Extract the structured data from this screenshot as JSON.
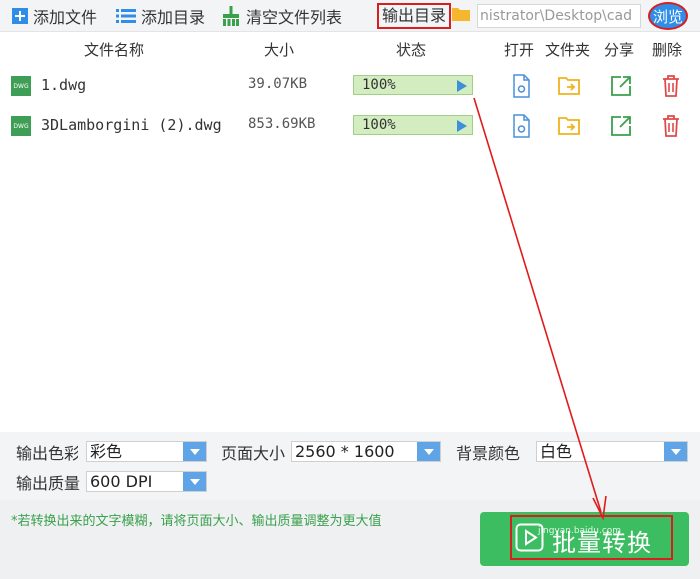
{
  "toolbar": {
    "add_file": "添加文件",
    "add_dir": "添加目录",
    "clear_list": "清空文件列表",
    "output_dir_label": "输出目录",
    "output_path": "nistrator\\Desktop\\cad",
    "browse": "浏览"
  },
  "table": {
    "headers": {
      "name": "文件名称",
      "size": "大小",
      "status": "状态",
      "open": "打开",
      "folder": "文件夹",
      "share": "分享",
      "delete": "删除"
    },
    "rows": [
      {
        "type": "DWG",
        "name": "1.dwg",
        "size": "39.07KB",
        "progress": "100%",
        "progress_value": 100
      },
      {
        "type": "DWG",
        "name": "3DLamborgini (2).dwg",
        "size": "853.69KB",
        "progress": "100%",
        "progress_value": 100
      }
    ]
  },
  "options": {
    "color_label": "输出色彩",
    "color_value": "彩色",
    "page_size_label": "页面大小",
    "page_size_value": "2560 * 1600",
    "bg_label": "背景颜色",
    "bg_value": "白色",
    "quality_label": "输出质量",
    "quality_value": "600 DPI"
  },
  "footer": {
    "hint": "*若转换出来的文字模糊，请将页面大小、输出质量调整为更大值",
    "convert": "批量转换",
    "watermark": "jingyan.baidu.com"
  },
  "colors": {
    "accent_blue": "#2f8ee8",
    "convert_green": "#3dbd61",
    "annotation_red": "#d81e1e",
    "hint_green": "#3aa04b"
  }
}
